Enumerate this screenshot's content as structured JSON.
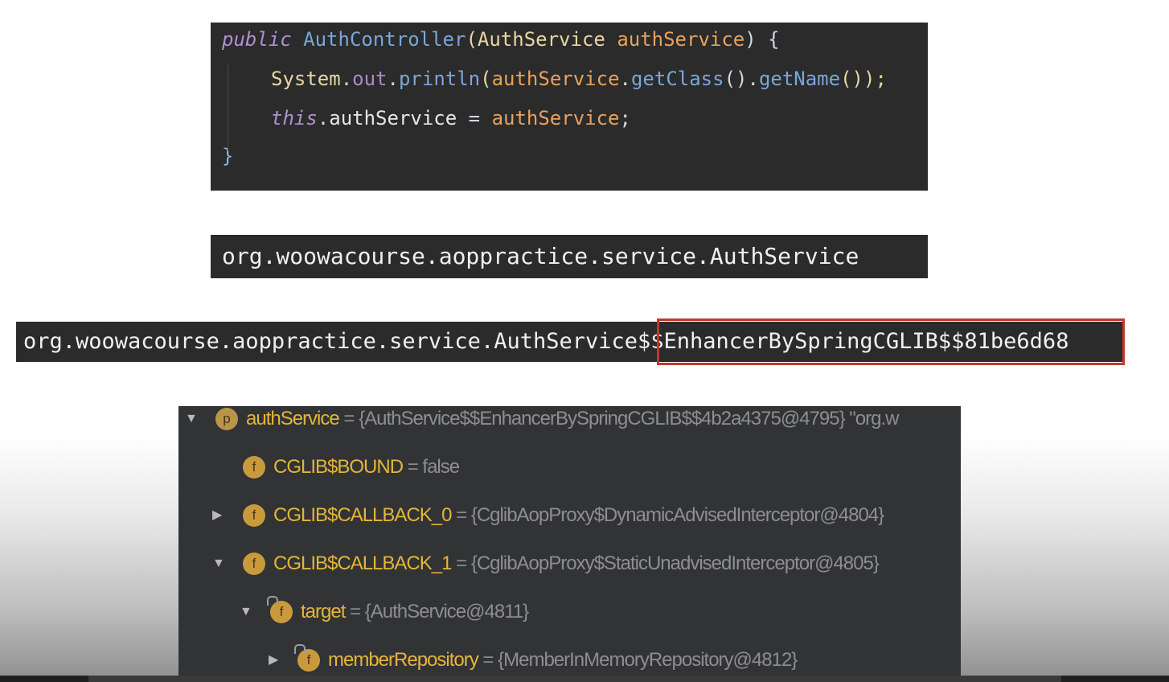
{
  "code": {
    "line1": {
      "kw": "public",
      "ctor": "AuthController",
      "open": "(",
      "type": "AuthService",
      "sp": " ",
      "param": "authService",
      "close": ") {"
    },
    "line2": {
      "cls": "System",
      "dot1": ".",
      "out": "out",
      "dot2": ".",
      "println": "println",
      "open": "(",
      "arg": "authService",
      "dot3": ".",
      "getClass": "getClass",
      "mid": "().",
      "getName": "getName",
      "close": "());"
    },
    "line3": {
      "this": "this",
      "dot": ".",
      "field": "authService",
      "eq": " = ",
      "val": "authService",
      "semi": ";"
    },
    "line4": "}"
  },
  "output1": "org.woowacourse.aoppractice.service.AuthService",
  "output2": {
    "prefix": "org.woowacourse.aoppractice.service.AuthService",
    "suffix": "$$EnhancerBySpringCGLIB$$81be6d68"
  },
  "colors": {
    "highlight_border": "#c0392b"
  },
  "debugger": {
    "rows": [
      {
        "icon": "p",
        "name": "authService",
        "eq": "=",
        "value": "{AuthService$$EnhancerBySpringCGLIB$$4b2a4375@4795} \"org.w"
      },
      {
        "icon": "f",
        "name": "CGLIB$BOUND",
        "eq": "=",
        "value": "false"
      },
      {
        "icon": "f",
        "name": "CGLIB$CALLBACK_0",
        "eq": "=",
        "value": "{CglibAopProxy$DynamicAdvisedInterceptor@4804}"
      },
      {
        "icon": "f",
        "name": "CGLIB$CALLBACK_1",
        "eq": "=",
        "value": "{CglibAopProxy$StaticUnadvisedInterceptor@4805}"
      },
      {
        "icon": "f",
        "name": "target",
        "eq": "=",
        "value": "{AuthService@4811}"
      },
      {
        "icon": "f",
        "name": "memberRepository",
        "eq": "=",
        "value": "{MemberInMemoryRepository@4812}"
      }
    ]
  }
}
